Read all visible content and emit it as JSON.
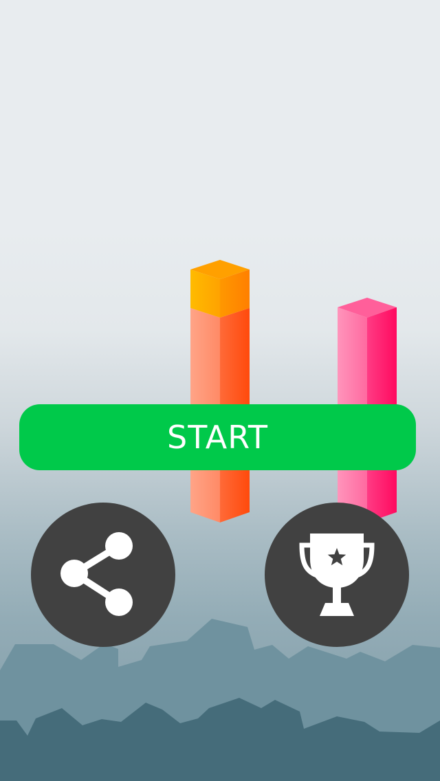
{
  "menu": {
    "start_label": "START",
    "share_icon": "share-icon",
    "leaderboard_icon": "trophy-icon"
  },
  "colors": {
    "start_button": "#00c94a",
    "round_button": "#414141",
    "orange_pillar": "#ff5a1f",
    "orange_cap": "#ff9900",
    "pink_pillar": "#ff2f7a"
  }
}
